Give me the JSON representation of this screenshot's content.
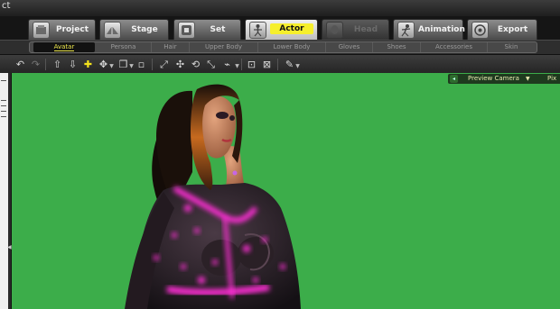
{
  "window": {
    "title": "ct"
  },
  "main_tabs": [
    {
      "label": "Project",
      "icon": "project-icon",
      "state": "normal"
    },
    {
      "label": "Stage",
      "icon": "stage-icon",
      "state": "normal"
    },
    {
      "label": "Set",
      "icon": "set-icon",
      "state": "normal"
    },
    {
      "label": "Actor",
      "icon": "actor-icon",
      "state": "active"
    },
    {
      "label": "Head",
      "icon": "head-icon",
      "state": "disabled"
    },
    {
      "label": "Animation",
      "icon": "animation-icon",
      "state": "normal"
    },
    {
      "label": "Export",
      "icon": "export-icon",
      "state": "normal"
    }
  ],
  "sub_tabs": [
    {
      "label": "Avatar",
      "active": true
    },
    {
      "label": "Persona",
      "active": false
    },
    {
      "label": "Hair",
      "active": false
    },
    {
      "label": "Upper Body",
      "active": false
    },
    {
      "label": "Lower Body",
      "active": false
    },
    {
      "label": "Gloves",
      "active": false
    },
    {
      "label": "Shoes",
      "active": false
    },
    {
      "label": "Accessories",
      "active": false
    },
    {
      "label": "Skin",
      "active": false
    }
  ],
  "toolbar": {
    "icons": [
      "undo-icon",
      "redo-icon",
      "move-up-icon",
      "move-down-icon",
      "move-icon",
      "rotate-icon",
      "scale-icon",
      "select-icon",
      "transform-icon",
      "reset-icon",
      "fit-icon",
      "align-icon",
      "frame-icon",
      "frame-all-icon",
      "brush-icon"
    ]
  },
  "viewport": {
    "background_color": "#3cad4a",
    "camera_label": "Preview Camera",
    "camera_extra": "Pix"
  },
  "colors": {
    "accent_yellow": "#f6ef2c",
    "highlight_magenta": "#ff2fd5"
  }
}
